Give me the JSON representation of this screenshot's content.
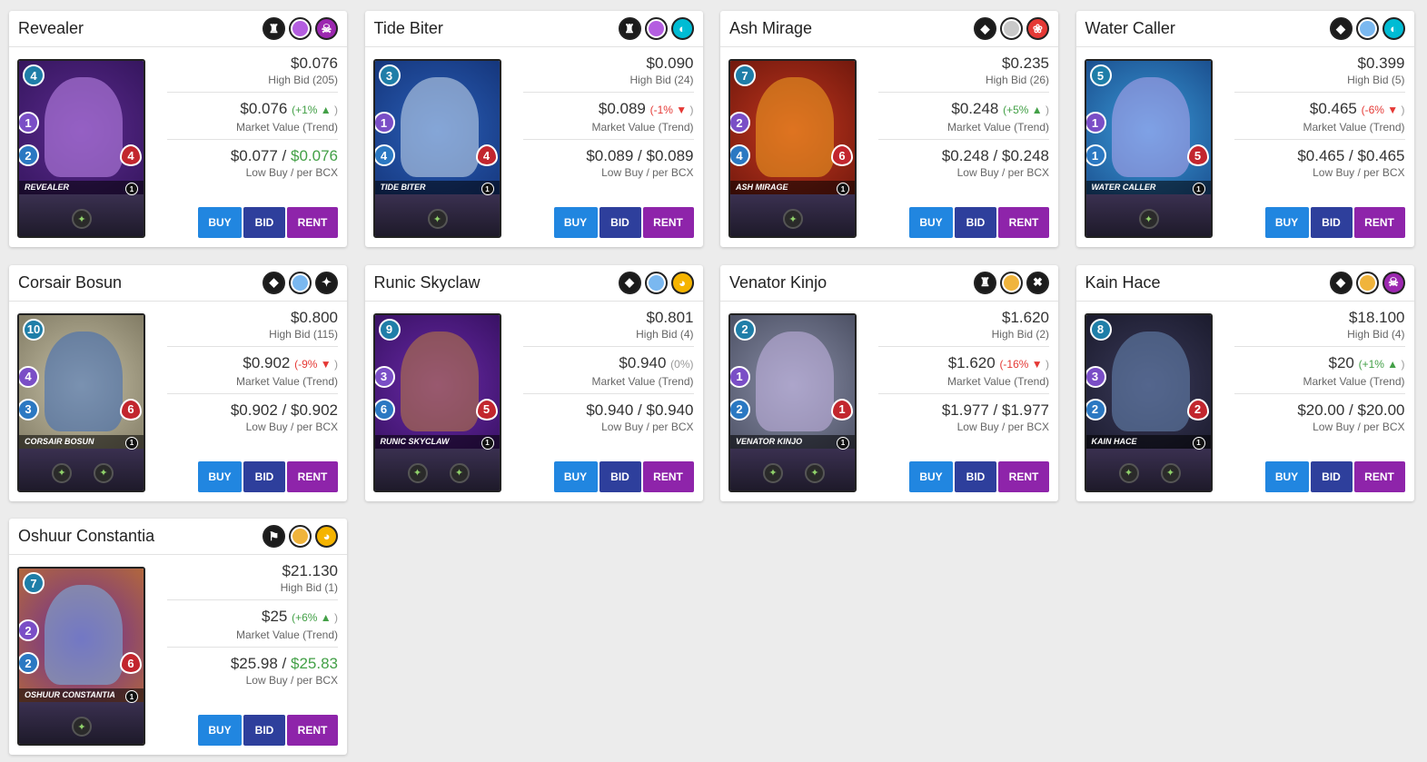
{
  "cards": [
    {
      "name": "Revealer",
      "badges": [
        {
          "icon": "tank-icon",
          "color": "#1b1b1b"
        },
        {
          "icon": "rarity-icon",
          "color": "#b45ee0"
        },
        {
          "icon": "death-element-icon",
          "color": "#9c27b0"
        }
      ],
      "price": "$0.076",
      "high_bid": "High Bid (205)",
      "market_value": "$0.076",
      "trend": "(+1%",
      "trend_dir": "up",
      "trend_close": ")",
      "market_label": "Market Value (Trend)",
      "low_buy": "$0.077",
      "per_bcx": "$0.076",
      "per_bcx_highlight": true,
      "low_label": "Low Buy / per BCX",
      "art": {
        "name": "Revealer",
        "mana": "4",
        "atk": "1",
        "spd": "2",
        "hp": "4",
        "lvl": "1",
        "bg1": "#5b2a8e",
        "bg2": "#2a1050",
        "fig": "#c58cf0",
        "abilities": [
          "ability-icon"
        ]
      }
    },
    {
      "name": "Tide Biter",
      "badges": [
        {
          "icon": "tank-icon",
          "color": "#1b1b1b"
        },
        {
          "icon": "rarity-icon",
          "color": "#b45ee0"
        },
        {
          "icon": "water-element-icon",
          "color": "#00bcd4"
        }
      ],
      "price": "$0.090",
      "high_bid": "High Bid (24)",
      "market_value": "$0.089",
      "trend": "(-1%",
      "trend_dir": "down",
      "trend_close": ")",
      "market_label": "Market Value (Trend)",
      "low_buy": "$0.089",
      "per_bcx": "$0.089",
      "per_bcx_highlight": false,
      "low_label": "Low Buy / per BCX",
      "art": {
        "name": "Tide Biter",
        "mana": "3",
        "atk": "1",
        "spd": "4",
        "hp": "4",
        "lvl": "1",
        "bg1": "#2a5fb8",
        "bg2": "#0f2a6a",
        "fig": "#cfe0f0",
        "abilities": [
          "ability-icon"
        ]
      }
    },
    {
      "name": "Ash Mirage",
      "badges": [
        {
          "icon": "dual-arrow-icon",
          "color": "#1b1b1b"
        },
        {
          "icon": "rarity-icon",
          "color": "#c9c9c9"
        },
        {
          "icon": "fire-element-icon",
          "color": "#e53935"
        }
      ],
      "price": "$0.235",
      "high_bid": "High Bid (26)",
      "market_value": "$0.248",
      "trend": "(+5%",
      "trend_dir": "up",
      "trend_close": ")",
      "market_label": "Market Value (Trend)",
      "low_buy": "$0.248",
      "per_bcx": "$0.248",
      "per_bcx_highlight": false,
      "low_label": "Low Buy / per BCX",
      "art": {
        "name": "Ash Mirage",
        "mana": "7",
        "atk": "2",
        "spd": "4",
        "hp": "6",
        "lvl": "1",
        "bg1": "#c2361e",
        "bg2": "#5a1008",
        "fig": "#f5a623",
        "abilities": [
          "ability-icon"
        ]
      }
    },
    {
      "name": "Water Caller",
      "badges": [
        {
          "icon": "dual-arrow-icon",
          "color": "#1b1b1b"
        },
        {
          "icon": "rarity-icon",
          "color": "#7ab8f0"
        },
        {
          "icon": "water-element-icon",
          "color": "#00bcd4"
        }
      ],
      "price": "$0.399",
      "high_bid": "High Bid (5)",
      "market_value": "$0.465",
      "trend": "(-6%",
      "trend_dir": "down",
      "trend_close": ")",
      "market_label": "Market Value (Trend)",
      "low_buy": "$0.465",
      "per_bcx": "$0.465",
      "per_bcx_highlight": false,
      "low_label": "Low Buy / per BCX",
      "art": {
        "name": "Water Caller",
        "mana": "5",
        "atk": "1",
        "spd": "1",
        "hp": "5",
        "lvl": "1",
        "bg1": "#3a9ad8",
        "bg2": "#123a7a",
        "fig": "#b8a8f0",
        "abilities": [
          "ability-icon"
        ]
      }
    },
    {
      "name": "Corsair Bosun",
      "badges": [
        {
          "icon": "dual-arrow-icon",
          "color": "#1b1b1b"
        },
        {
          "icon": "rarity-icon",
          "color": "#7ab8f0"
        },
        {
          "icon": "neutral-element-icon",
          "color": "#1b1b1b"
        }
      ],
      "price": "$0.800",
      "high_bid": "High Bid (115)",
      "market_value": "$0.902",
      "trend": "(-9%",
      "trend_dir": "down",
      "trend_close": ")",
      "market_label": "Market Value (Trend)",
      "low_buy": "$0.902",
      "per_bcx": "$0.902",
      "per_bcx_highlight": false,
      "low_label": "Low Buy / per BCX",
      "art": {
        "name": "Corsair Bosun",
        "mana": "10",
        "atk": "4",
        "spd": "3",
        "hp": "6",
        "lvl": "1",
        "bg1": "#c8c2a8",
        "bg2": "#6c6650",
        "fig": "#3a6ab8",
        "abilities": [
          "ability-icon",
          "ability-icon"
        ]
      }
    },
    {
      "name": "Runic Skyclaw",
      "badges": [
        {
          "icon": "dual-arrow-icon",
          "color": "#1b1b1b"
        },
        {
          "icon": "rarity-icon",
          "color": "#7ab8f0"
        },
        {
          "icon": "earth-element-icon",
          "color": "#f5b400"
        }
      ],
      "price": "$0.801",
      "high_bid": "High Bid (4)",
      "market_value": "$0.940",
      "trend": "(0%",
      "trend_dir": "flat",
      "trend_close": ")",
      "market_label": "Market Value (Trend)",
      "low_buy": "$0.940",
      "per_bcx": "$0.940",
      "per_bcx_highlight": false,
      "low_label": "Low Buy / per BCX",
      "art": {
        "name": "Runic Skyclaw",
        "mana": "9",
        "atk": "3",
        "spd": "6",
        "hp": "5",
        "lvl": "1",
        "bg1": "#6a2aa8",
        "bg2": "#2a0a50",
        "fig": "#c08040",
        "abilities": [
          "ability-icon",
          "ability-icon"
        ]
      }
    },
    {
      "name": "Venator Kinjo",
      "badges": [
        {
          "icon": "tank-icon",
          "color": "#1b1b1b"
        },
        {
          "icon": "rarity-icon",
          "color": "#f0b43c"
        },
        {
          "icon": "crossed-swords-icon",
          "color": "#1b1b1b"
        }
      ],
      "price": "$1.620",
      "high_bid": "High Bid (2)",
      "market_value": "$1.620",
      "trend": "(-16%",
      "trend_dir": "down",
      "trend_close": ")",
      "market_label": "Market Value (Trend)",
      "low_buy": "$1.977",
      "per_bcx": "$1.977",
      "per_bcx_highlight": false,
      "low_label": "Low Buy / per BCX",
      "art": {
        "name": "Venator Kinjo",
        "mana": "2",
        "atk": "1",
        "spd": "2",
        "hp": "1",
        "lvl": "1",
        "bg1": "#8a8fa8",
        "bg2": "#3a3e50",
        "fig": "#c8b8e8",
        "abilities": [
          "ability-icon",
          "ability-icon"
        ]
      }
    },
    {
      "name": "Kain Hace",
      "badges": [
        {
          "icon": "dual-arrow-icon",
          "color": "#1b1b1b"
        },
        {
          "icon": "rarity-icon",
          "color": "#f0b43c"
        },
        {
          "icon": "death-element-icon",
          "color": "#9c27b0"
        }
      ],
      "price": "$18.100",
      "high_bid": "High Bid (4)",
      "market_value": "$20",
      "trend": "(+1%",
      "trend_dir": "up",
      "trend_close": ")",
      "market_label": "Market Value (Trend)",
      "low_buy": "$20.00",
      "per_bcx": "$20.00",
      "per_bcx_highlight": false,
      "low_label": "Low Buy / per BCX",
      "art": {
        "name": "Kain Hace",
        "mana": "8",
        "atk": "3",
        "spd": "2",
        "hp": "2",
        "lvl": "1",
        "bg1": "#3a3a5a",
        "bg2": "#121220",
        "fig": "#6a8ab8",
        "abilities": [
          "ability-icon",
          "ability-icon"
        ]
      }
    },
    {
      "name": "Oshuur Constantia",
      "badges": [
        {
          "icon": "flag-icon",
          "color": "#1b1b1b"
        },
        {
          "icon": "rarity-icon",
          "color": "#f0b43c"
        },
        {
          "icon": "earth-element-icon",
          "color": "#f5b400"
        }
      ],
      "price": "$21.130",
      "high_bid": "High Bid (1)",
      "market_value": "$25",
      "trend": "(+6%",
      "trend_dir": "up",
      "trend_close": ")",
      "market_label": "Market Value (Trend)",
      "low_buy": "$25.98",
      "per_bcx": "$25.83",
      "per_bcx_highlight": true,
      "low_label": "Low Buy / per BCX",
      "art": {
        "name": "Oshuur Constantia",
        "mana": "7",
        "atk": "2",
        "spd": "2",
        "hp": "6",
        "lvl": "1",
        "bg1": "#6a2a9a",
        "bg2": "#c87a20",
        "fig": "#7ab8e8",
        "abilities": [
          "ability-icon"
        ]
      }
    }
  ],
  "buttons": {
    "buy": "BUY",
    "bid": "BID",
    "rent": "RENT"
  },
  "colors": {
    "buy": "#2186e0",
    "bid": "#2e3f9c",
    "rent": "#8e24aa",
    "up": "#43a047",
    "down": "#e53935"
  }
}
